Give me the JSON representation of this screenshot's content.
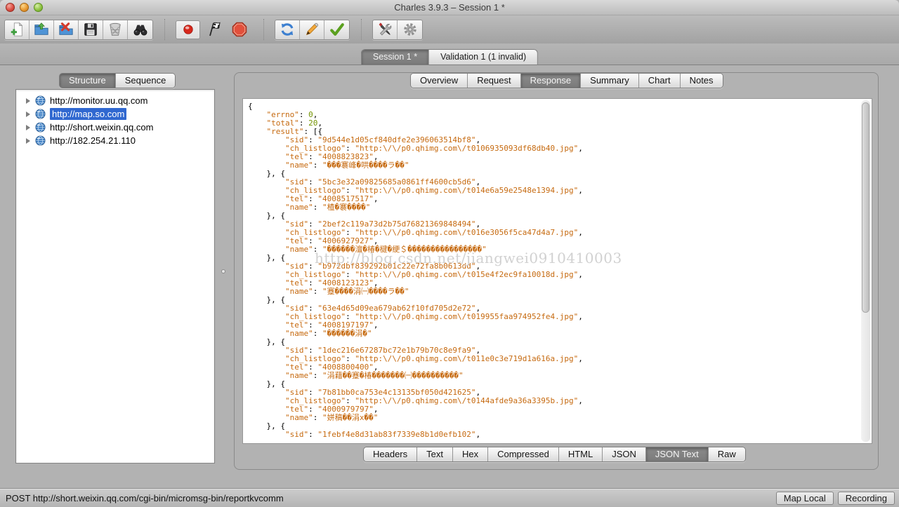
{
  "window": {
    "title": "Charles 3.9.3 – Session 1 *"
  },
  "toolbar": {
    "buttons": [
      "new-session",
      "open-session",
      "close-session",
      "save-session",
      "clear-session",
      "find",
      "record",
      "throttle",
      "stop",
      "repeat",
      "edit",
      "validate",
      "tools",
      "settings"
    ]
  },
  "session_tabs": {
    "tabs": [
      {
        "label": "Session 1 *"
      },
      {
        "label": "Validation 1 (1 invalid)"
      }
    ]
  },
  "sidebar": {
    "tabs": [
      {
        "label": "Structure"
      },
      {
        "label": "Sequence"
      }
    ],
    "items": [
      {
        "url": "http://monitor.uu.qq.com"
      },
      {
        "url": "http://map.so.com"
      },
      {
        "url": "http://short.weixin.qq.com"
      },
      {
        "url": "http://182.254.21.110"
      }
    ]
  },
  "response_view": {
    "tabs": [
      {
        "label": "Overview"
      },
      {
        "label": "Request"
      },
      {
        "label": "Response"
      },
      {
        "label": "Summary"
      },
      {
        "label": "Chart"
      },
      {
        "label": "Notes"
      }
    ],
    "bottom_tabs": [
      {
        "label": "Headers"
      },
      {
        "label": "Text"
      },
      {
        "label": "Hex"
      },
      {
        "label": "Compressed"
      },
      {
        "label": "HTML"
      },
      {
        "label": "JSON"
      },
      {
        "label": "JSON Text"
      },
      {
        "label": "Raw"
      }
    ],
    "body_lines": [
      "{",
      "    \"errno\": 0,",
      "    \"total\": 20,",
      "    \"result\": [{",
      "        \"sid\": \"9d544e1d05cf840dfe2e396063514bf8\",",
      "        \"ch_listlogo\": \"http:\\/\\/p0.qhimg.com\\/t0106935093df68db40.jpg\",",
      "        \"tel\": \"4008823823\",",
      "        \"name\": \"���褰峰�哄����ラ��\"",
      "    }, {",
      "        \"sid\": \"5bc3e32a09825685a0861ff4600cb5d6\",",
      "        \"ch_listlogo\": \"http:\\/\\/p0.qhimg.com\\/t014e6a59e2548e1394.jpg\",",
      "        \"tel\": \"4008517517\",",
      "        \"name\": \"楂�褰����\"",
      "    }, {",
      "        \"sid\": \"2bef2c119a73d2b75d76821369848494\",",
      "        \"ch_listlogo\": \"http:\\/\\/p0.qhimg.com\\/t016e3056f5ca47d4a7.jpg\",",
      "        \"tel\": \"4006927927\",",
      "        \"name\": \"������澶�椿�楗�绠＄����������������\"",
      "    }, {",
      "        \"sid\": \"b972dbf839292b01c22e72fa8b0613dd\",",
      "        \"ch_listlogo\": \"http:\\/\\/p0.qhimg.com\\/t015e4f2ec9fa10018d.jpg\",",
      "        \"tel\": \"4008123123\",",
      "        \"name\": \"蹇����涓㈠����ラ��\"",
      "    }, {",
      "        \"sid\": \"63e4d65d09ea679ab62f10fd705d2e72\",",
      "        \"ch_listlogo\": \"http:\\/\\/p0.qhimg.com\\/t019955faa974952fe4.jpg\",",
      "        \"tel\": \"4008197197\",",
      "        \"name\": \"������涓�\"",
      "    }, {",
      "        \"sid\": \"1dec216e67287bc72e1b79b70c8e9fa9\",",
      "        \"ch_listlogo\": \"http:\\/\\/p0.qhimg.com\\/t011e0c3e719d1a616a.jpg\",",
      "        \"tel\": \"4008800400\",",
      "        \"name\": \"涓藉��蹇�椿�������㈠����������\"",
      "    }, {",
      "        \"sid\": \"7b81bb0ca753e4c13135bf050d421625\",",
      "        \"ch_listlogo\": \"http:\\/\\/p0.qhimg.com\\/t0144afde9a36a3395b.jpg\",",
      "        \"tel\": \"4000979797\",",
      "        \"name\": \"姘稿��涓х��\"",
      "    }, {",
      "        \"sid\": \"1febf4e8d31ab83f7339e8b1d0efb102\","
    ]
  },
  "watermark": {
    "text": "http://blog.csdn.net/jiangwei0910410003"
  },
  "status_bar": {
    "request": "POST http://short.weixin.qq.com/cgi-bin/micromsg-bin/reportkvcomm",
    "map_local_label": "Map Local",
    "recording_label": "Recording"
  },
  "colors": {
    "syntax_string": "#c66a10",
    "syntax_number": "#739200",
    "selection_blue": "#3068d0"
  }
}
